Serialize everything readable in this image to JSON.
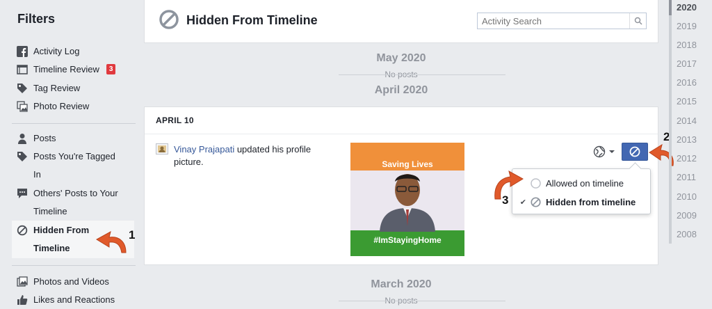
{
  "sidebar": {
    "title": "Filters",
    "items": [
      {
        "label": "Activity Log",
        "icon": "facebook-icon"
      },
      {
        "label": "Timeline Review",
        "icon": "timeline-icon",
        "badge": "3"
      },
      {
        "label": "Tag Review",
        "icon": "tag-icon"
      },
      {
        "label": "Photo Review",
        "icon": "photo-stack-icon"
      }
    ],
    "items2": [
      {
        "label": "Posts",
        "icon": "person-icon"
      },
      {
        "label": "Posts You're Tagged In",
        "line1": "Posts You're Tagged",
        "line2": "In",
        "icon": "tag-icon"
      },
      {
        "label": "Others' Posts to Your Timeline",
        "line1": "Others' Posts to Your",
        "line2": "Timeline",
        "icon": "speech-bubble-icon"
      },
      {
        "label": "Hidden From Timeline",
        "line1": "Hidden From",
        "line2": "Timeline",
        "icon": "block-icon",
        "active": true
      }
    ],
    "items3": [
      {
        "label": "Photos and Videos",
        "icon": "photos-icon"
      },
      {
        "label": "Likes and Reactions",
        "icon": "thumbs-up-icon"
      }
    ]
  },
  "header": {
    "title": "Hidden From Timeline",
    "search_placeholder": "Activity Search"
  },
  "timeline": {
    "may": {
      "month": "May 2020",
      "empty": "No posts"
    },
    "april": {
      "month": "April 2020"
    },
    "march": {
      "month": "March 2020",
      "empty": "No posts"
    }
  },
  "post": {
    "date": "APRIL 10",
    "author": "Vinay Prajapati",
    "action": " updated his profile picture.",
    "photo_text_top": "Saving Lives",
    "photo_text_bottom": "#ImStayingHome"
  },
  "dropdown": {
    "option1": "Allowed on timeline",
    "option2": "Hidden from timeline",
    "selected": "Hidden from timeline"
  },
  "years": [
    "2020",
    "2019",
    "2018",
    "2017",
    "2016",
    "2015",
    "2014",
    "2013",
    "2012",
    "2011",
    "2010",
    "2009",
    "2008"
  ],
  "annotations": {
    "step1": "1",
    "step2": "2",
    "step3": "3"
  },
  "colors": {
    "accent": "#4267b2",
    "link": "#365899",
    "arrow": "#e05a2b",
    "badge": "#e0393e"
  }
}
